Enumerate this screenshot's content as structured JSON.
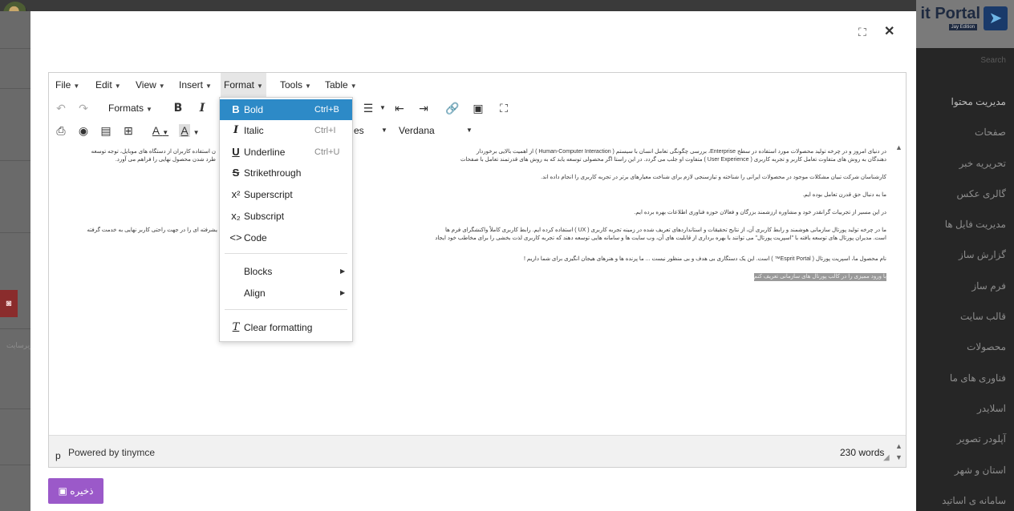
{
  "background": {
    "brand_text": "it Portal",
    "brand_sub": "Jay Edition",
    "search_placeholder": "Search",
    "sidebar_items": [
      "مدیریت محتوا",
      "صفحات",
      "تحریریه خبر",
      "گالری عکس",
      "مدیریت فایل ها",
      "گزارش ساز",
      "فرم ساز",
      "قالب سایت",
      "محصولات",
      "فناوری های ما",
      "اسلایدر",
      "آپلودر تصویر",
      "استان و شهر",
      "سامانه ی اساتید"
    ],
    "left_text": "زیرسایت"
  },
  "modal": {
    "expand_icon": "⛶",
    "close_icon": "✕"
  },
  "editor": {
    "menubar": {
      "file": "File",
      "edit": "Edit",
      "view": "View",
      "insert": "Insert",
      "format": "Format",
      "tools": "Tools",
      "table": "Table"
    },
    "toolbar": {
      "formats": "Formats",
      "bold": "B",
      "italic": "I",
      "styles_tail": "es",
      "font": "Verdana"
    },
    "content": {
      "p1_line1": "در دنیای امروز و در چرخه تولید محصولات مورد استفاده در سطح  Enterprise، بررسی چگونگی تعامل انسان با سیستم ( Human-Computer Interaction ) از اهمیت بالایی برخوردار",
      "p1_line2": "دهندگان به روش های متفاوت تعامل کاربر و تجربه کاربری ( User Experience ) متفاوت او جلب می گردد. در این راستا اگر محصولی توسعه یابد که به روش های قدرتمند تعامل با صفحات",
      "p1_left1": "ن استفاده کاربران از دستگاه های موبایل، توجه توسعه",
      "p1_left2": "طرد شدن محصول نهایی را فراهم می آورد.",
      "p2": "کارشناسان شرکت تبیان مشکلات موجود در محصولات ایرانی را شناخته و تیازسنجی لازم برای شناخت معیارهای برتر در تجربه کاربری را انجام داده اند.",
      "p3": "ما به دنبال حق قدرن تعامل بوده ایم.",
      "p4": "در این مسیر از تجربیات گرانقدر خود و مشاوره ارزشمند بزرگان و فعالان حوزه فناوری اطلاعات بهره برده ایم.",
      "p5_line1": "ما در چرخه تولید پورتال سازمانی هوشمند  و رابط کاربری آن، از نتایج تحقیقات و استانداردهای تعریف شده در زمینه تجربه کاربری ( UX ) استفاده کرده ایم. رابط کاربری کاملاً واکنشگرای فرم ها",
      "p5_line2": "است. مدیران پورتال های توسعه یافته با \"اسپریت پورتال\" می توانند با بهره برداری از قابلیت های آن، وب سایت ها و سامانه هایی توسعه دهند که تجربه کاربری لذت بخشی را برای مخاطب خود ایجاد",
      "p5_left": "یشرفته ای را در جهت راحتی کاربر نهایی به خدمت گرفته",
      "p6": "نام محصول ما، اسپریت پورتال ( Esprit Portal™ ) است. این یک دستگاری بی هدف و بی منظور نیست ... ما پرنده ها و هنرهای هیجان انگیزی برای شما داریم !",
      "p7": "با ورود ممیزی را در کالب پورتال های سازمانی تعریف کنم"
    },
    "statusbar": {
      "path": "p",
      "powered": "Powered by tinymce",
      "words": "230 words"
    }
  },
  "format_menu": {
    "bold": "Bold",
    "bold_shortcut": "Ctrl+B",
    "italic": "Italic",
    "italic_shortcut": "Ctrl+I",
    "underline": "Underline",
    "underline_shortcut": "Ctrl+U",
    "strikethrough": "Strikethrough",
    "superscript": "Superscript",
    "subscript": "Subscript",
    "code": "Code",
    "blocks": "Blocks",
    "align": "Align",
    "clear": "Clear formatting"
  },
  "save_button": "ذخیره"
}
